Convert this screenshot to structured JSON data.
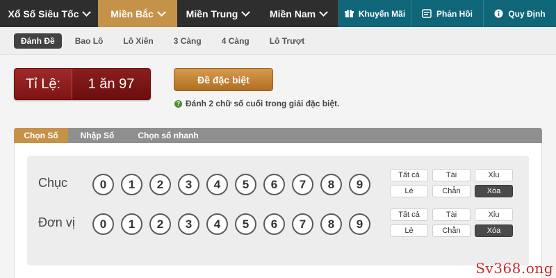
{
  "topnav": {
    "items": [
      {
        "label": "Xổ Số Siêu Tốc",
        "dropdown": true,
        "active": false
      },
      {
        "label": "Miền Bắc",
        "dropdown": true,
        "active": true
      },
      {
        "label": "Miền Trung",
        "dropdown": true,
        "active": false
      },
      {
        "label": "Miền Nam",
        "dropdown": true,
        "active": false
      }
    ],
    "extras": [
      {
        "label": "Khuyến Mãi",
        "icon": "gift-icon"
      },
      {
        "label": "Phản Hồi",
        "icon": "feedback-icon"
      },
      {
        "label": "Quy Định",
        "icon": "info-icon"
      }
    ]
  },
  "subnav": {
    "items": [
      "Đánh Đề",
      "Bao Lô",
      "Lô Xiên",
      "3 Càng",
      "4 Càng",
      "Lô Trượt"
    ],
    "active_index": 0
  },
  "rate": {
    "label": "Tỉ Lệ:",
    "value": "1 ăn 97"
  },
  "bet_type_button": "Đề đặc biệt",
  "hint": "Đánh 2 chữ số cuối trong giải đặc biệt.",
  "tabs": {
    "items": [
      "Chọn Số",
      "Nhập Số",
      "Chọn số nhanh"
    ],
    "active_index": 0
  },
  "rows": [
    {
      "label": "Chục",
      "digits": [
        "0",
        "1",
        "2",
        "3",
        "4",
        "5",
        "6",
        "7",
        "8",
        "9"
      ],
      "quick": [
        "Tất cả",
        "Tài",
        "Xỉu",
        "Lẻ",
        "Chẵn",
        "Xóa"
      ]
    },
    {
      "label": "Đơn vị",
      "digits": [
        "0",
        "1",
        "2",
        "3",
        "4",
        "5",
        "6",
        "7",
        "8",
        "9"
      ],
      "quick": [
        "Tất cả",
        "Tài",
        "Xỉu",
        "Lẻ",
        "Chẵn",
        "Xóa"
      ]
    }
  ],
  "watermark": "Sv368.ong",
  "colors": {
    "accent": "#c5924a",
    "teal": "#0f6678",
    "rate_red": "#8a1e1e",
    "nav_dark": "#2e2e2e"
  }
}
